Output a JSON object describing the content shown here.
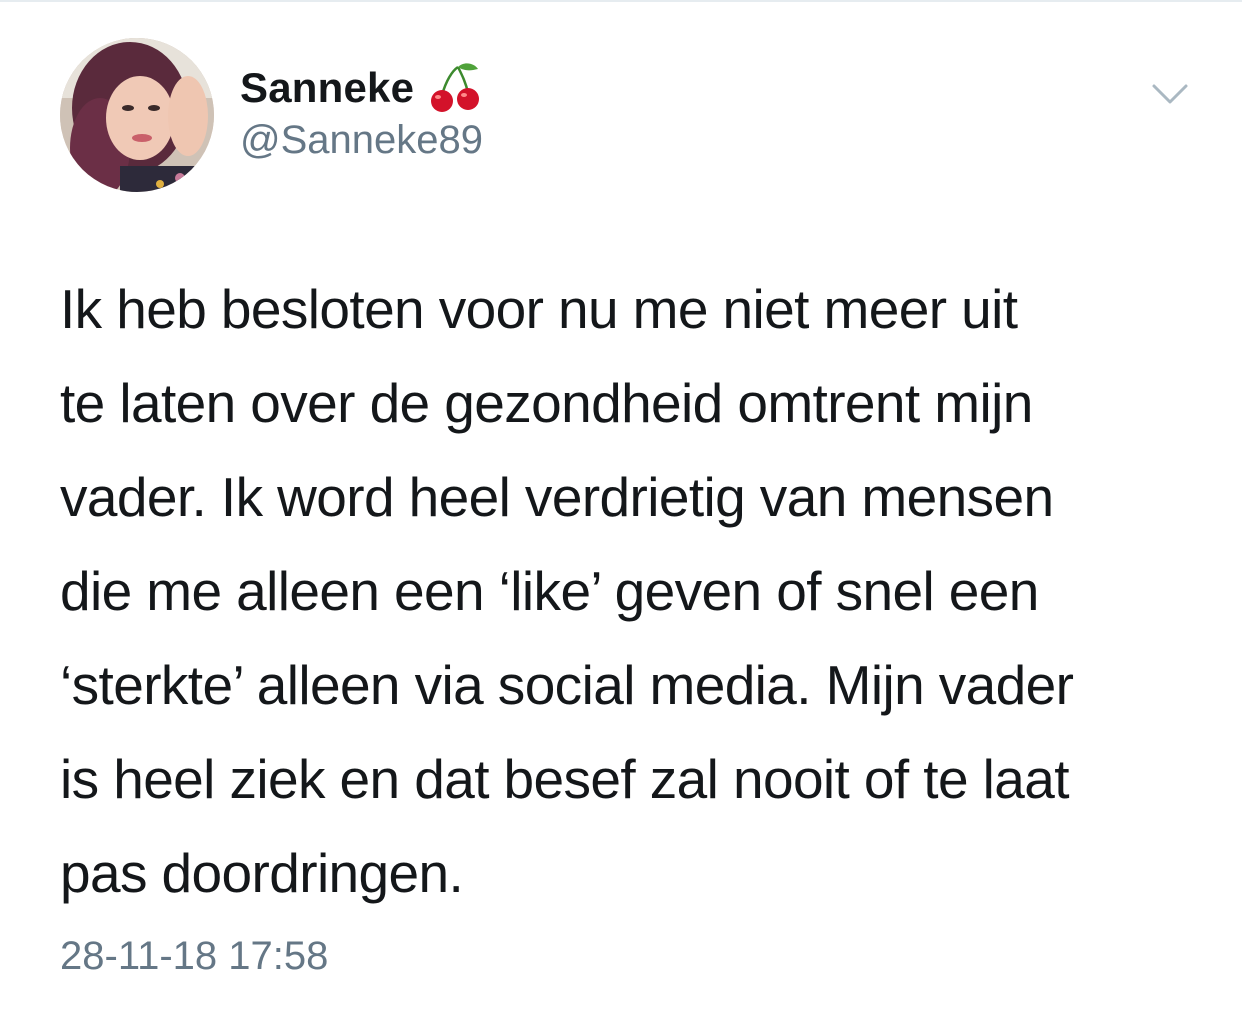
{
  "tweet": {
    "author": {
      "display_name": "Sanneke",
      "handle": "@Sanneke89",
      "name_emoji_icon": "cherries-icon"
    },
    "menu_icon": "chevron-down-icon",
    "text": "Ik heb besloten voor nu me niet meer uit\nte laten over de gezondheid omtrent mijn\nvader. Ik word heel verdrietig van mensen\ndie me alleen een ‘like’ geven of snel een\n‘sterkte’ alleen via social media. Mijn vader\nis heel ziek en dat besef zal nooit of te laat\npas doordringen.",
    "timestamp": "28-11-18 17:58"
  },
  "colors": {
    "text_primary": "#14171a",
    "text_secondary": "#657786",
    "divider": "#e6ecf0",
    "caret": "#aab8c2",
    "cherry_red": "#d3122a",
    "cherry_stem": "#3c8a2e"
  }
}
